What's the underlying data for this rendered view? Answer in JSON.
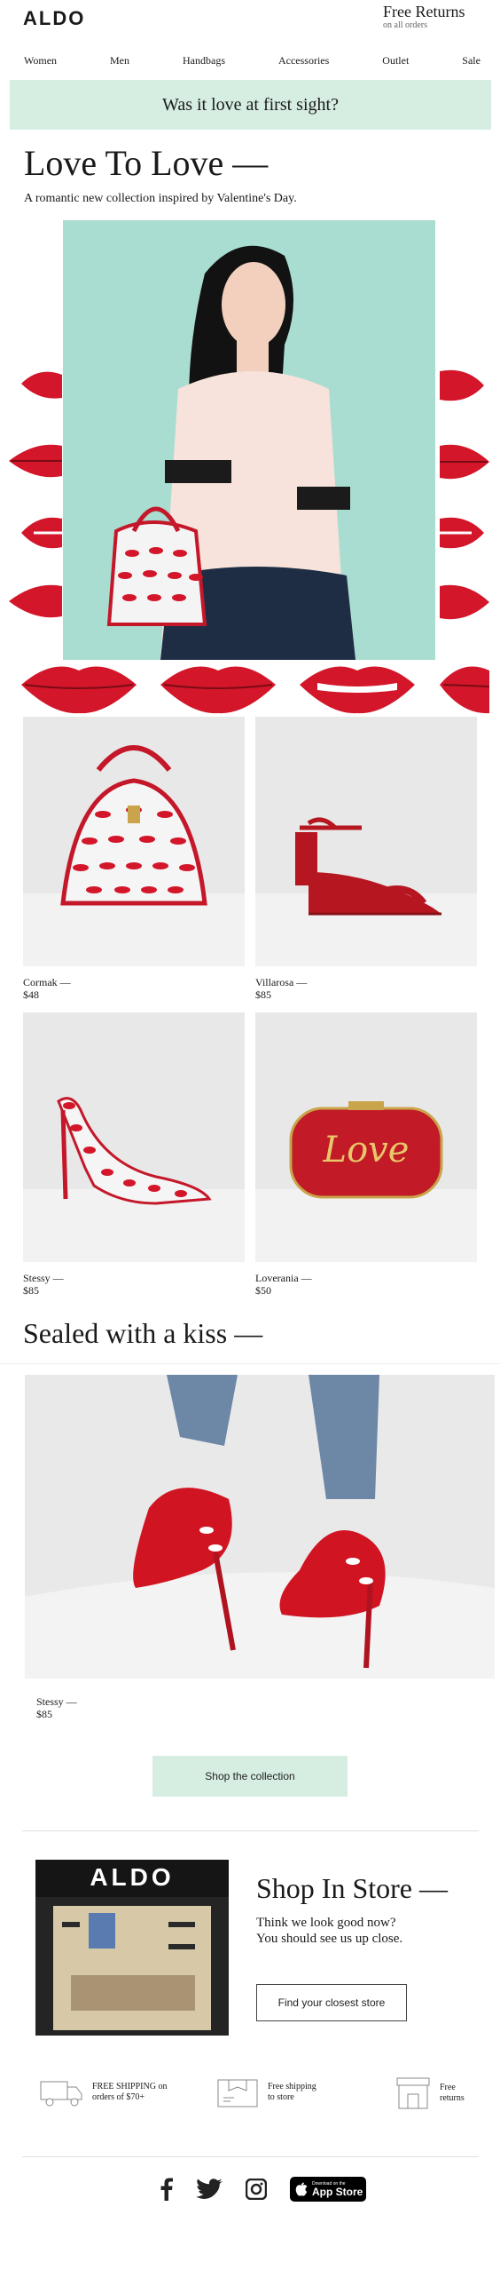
{
  "header": {
    "logo": "ALDO",
    "returns_title": "Free Returns",
    "returns_sub": "on all orders"
  },
  "nav": [
    "Women",
    "Men",
    "Handbags",
    "Accessories",
    "Outlet",
    "Sale"
  ],
  "banner": "Was it love at first sight?",
  "hero": {
    "title": "Love To Love —",
    "subtitle": "A romantic new collection inspired by Valentine's Day."
  },
  "products": [
    {
      "name": "Cormak —",
      "price": "$48",
      "icon": "lip-print-handbag"
    },
    {
      "name": "Villarosa —",
      "price": "$85",
      "icon": "red-block-heel-sandal"
    },
    {
      "name": "Stessy —",
      "price": "$85",
      "icon": "lip-print-pump"
    },
    {
      "name": "Loverania —",
      "price": "$50",
      "icon": "red-love-clutch"
    }
  ],
  "clutch_text": "Love",
  "sealed": {
    "title": "Sealed with a kiss —",
    "name": "Stessy —",
    "price": "$85"
  },
  "cta": "Shop the collection",
  "store": {
    "logo": "ALDO",
    "title": "Shop In Store —",
    "line1": "Think we look good now?",
    "line2": "You should see us up close.",
    "button": "Find your closest store"
  },
  "features": [
    {
      "line1": "FREE SHIPPING on",
      "line2": "orders of $70+",
      "icon": "truck-icon"
    },
    {
      "line1": "Free shipping",
      "line2": "to store",
      "icon": "box-icon"
    },
    {
      "line1": "Free",
      "line2": "returns",
      "icon": "store-icon"
    }
  ],
  "app_badge": {
    "small": "Download on the",
    "big": "App Store"
  },
  "colors": {
    "mint": "#d6ede2",
    "lip_red": "#d3162a",
    "hero_bg": "#a9ddd1"
  }
}
